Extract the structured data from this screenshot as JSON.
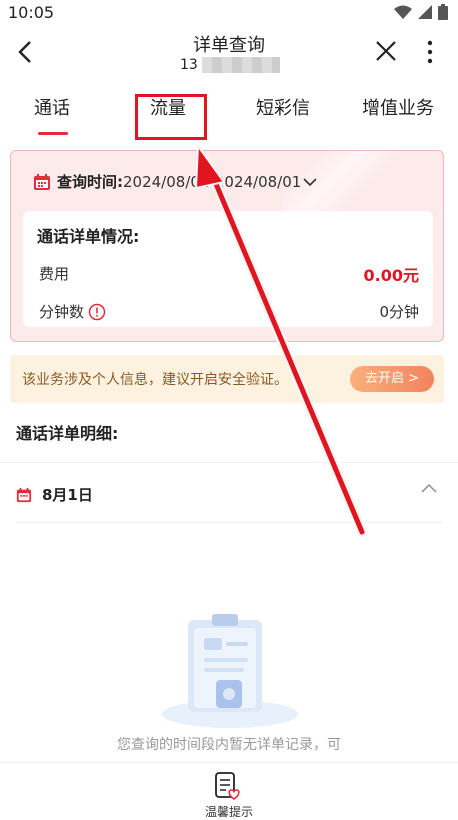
{
  "status_bar": {
    "time": "10:05"
  },
  "nav": {
    "title": "详单查询",
    "phone_prefix": "13"
  },
  "tabs": [
    {
      "label": "通话",
      "active": true
    },
    {
      "label": "流量",
      "active": false
    },
    {
      "label": "短彩信",
      "active": false
    },
    {
      "label": "增值业务",
      "active": false
    }
  ],
  "query": {
    "label": "查询时间:",
    "value": "2024/08/01-2024/08/01"
  },
  "summary": {
    "title": "通话详单情况:",
    "fee_label": "费用",
    "fee_value": "0.00元",
    "minutes_label": "分钟数",
    "minutes_value": "0分钟"
  },
  "banner": {
    "text": "该业务涉及个人信息，建议开启安全验证。",
    "button": "去开启 >"
  },
  "detail": {
    "section_title": "通话详单明细:",
    "date": "8月1日"
  },
  "empty": {
    "text": "您查询的时间段内暂无详单记录，可"
  },
  "bottom": {
    "tip_label": "温馨提示"
  },
  "colors": {
    "accent": "#e02e3a",
    "annotation": "#e0151f"
  }
}
